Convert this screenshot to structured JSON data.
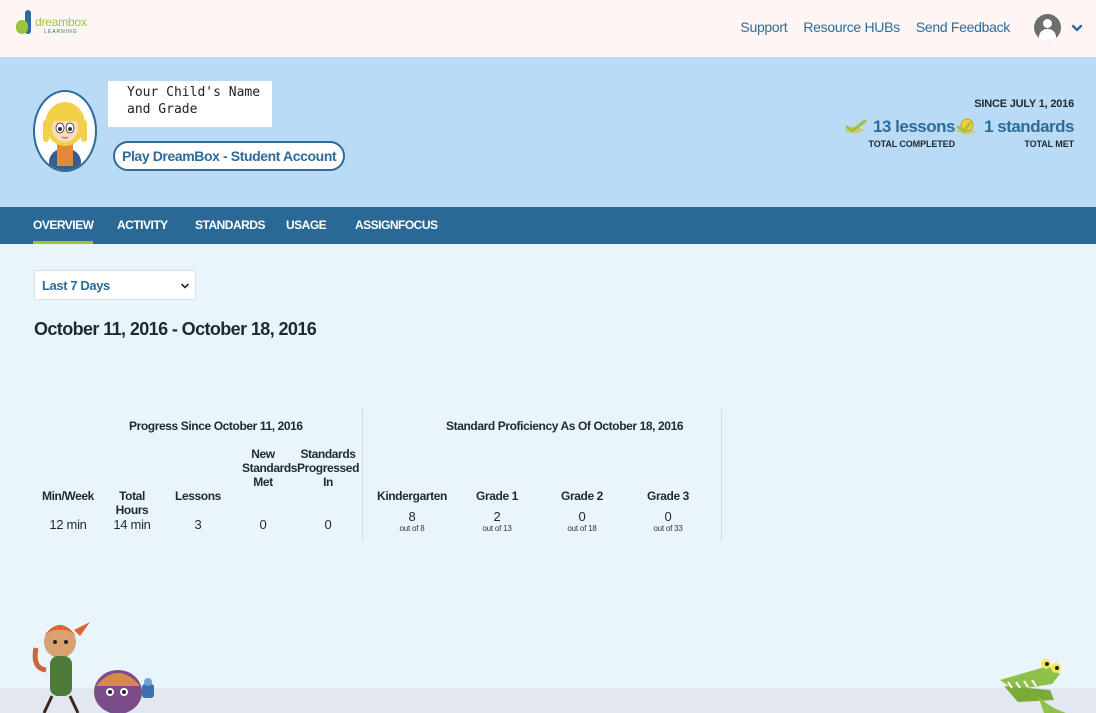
{
  "brand": {
    "name": "dreambox",
    "sub": "LEARNING",
    "green": "#9ac33e",
    "blue": "#2d6b98"
  },
  "topnav": {
    "support": "Support",
    "resource_hubs": "Resource HUBs",
    "send_feedback": "Send Feedback"
  },
  "profile": {
    "name_line1": "Your Child's Name",
    "name_line2": "and Grade",
    "play_button": "Play DreamBox - Student Account",
    "since": "SINCE JULY 1, 2016",
    "lessons_value": "13 lessons",
    "lessons_label": "TOTAL COMPLETED",
    "standards_value": "1 standards",
    "standards_label": "TOTAL MET"
  },
  "tabs": [
    "OVERVIEW",
    "ACTIVITY",
    "STANDARDS",
    "USAGE",
    "ASSIGNFOCUS"
  ],
  "filters": {
    "range_selected": "Last 7 Days"
  },
  "date_range": "October 11, 2016 - October 18, 2016",
  "progress": {
    "title": "Progress Since October 11, 2016",
    "columns": [
      {
        "label": "Min/Week",
        "value": "12 min"
      },
      {
        "label": "Total Hours",
        "value": "14 min"
      },
      {
        "label": "Lessons",
        "value": "3"
      },
      {
        "label": "New Standards Met",
        "value": "0"
      },
      {
        "label": "Standards Progressed In",
        "value": "0"
      }
    ]
  },
  "proficiency": {
    "title": "Standard Proficiency As Of October 18, 2016",
    "columns": [
      {
        "label": "Kindergarten",
        "value": "8",
        "sub": "out of 8"
      },
      {
        "label": "Grade 1",
        "value": "2",
        "sub": "out of 13"
      },
      {
        "label": "Grade 2",
        "value": "0",
        "sub": "out of 18"
      },
      {
        "label": "Grade 3",
        "value": "0",
        "sub": "out of 33"
      }
    ]
  }
}
